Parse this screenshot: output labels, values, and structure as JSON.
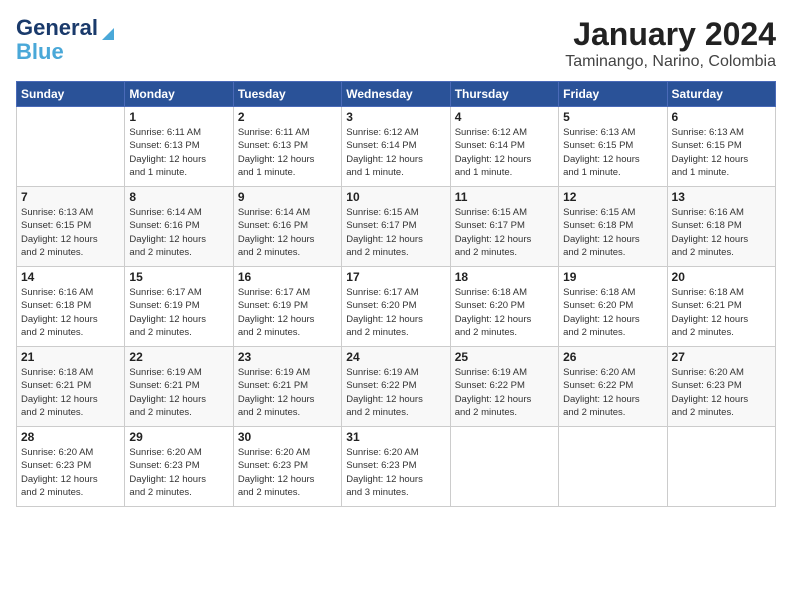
{
  "logo": {
    "line1": "General",
    "line2": "Blue"
  },
  "header": {
    "title": "January 2024",
    "location": "Taminango, Narino, Colombia"
  },
  "days_of_week": [
    "Sunday",
    "Monday",
    "Tuesday",
    "Wednesday",
    "Thursday",
    "Friday",
    "Saturday"
  ],
  "weeks": [
    [
      {
        "day": "",
        "info": ""
      },
      {
        "day": "1",
        "info": "Sunrise: 6:11 AM\nSunset: 6:13 PM\nDaylight: 12 hours\nand 1 minute."
      },
      {
        "day": "2",
        "info": "Sunrise: 6:11 AM\nSunset: 6:13 PM\nDaylight: 12 hours\nand 1 minute."
      },
      {
        "day": "3",
        "info": "Sunrise: 6:12 AM\nSunset: 6:14 PM\nDaylight: 12 hours\nand 1 minute."
      },
      {
        "day": "4",
        "info": "Sunrise: 6:12 AM\nSunset: 6:14 PM\nDaylight: 12 hours\nand 1 minute."
      },
      {
        "day": "5",
        "info": "Sunrise: 6:13 AM\nSunset: 6:15 PM\nDaylight: 12 hours\nand 1 minute."
      },
      {
        "day": "6",
        "info": "Sunrise: 6:13 AM\nSunset: 6:15 PM\nDaylight: 12 hours\nand 1 minute."
      }
    ],
    [
      {
        "day": "7",
        "info": "Sunrise: 6:13 AM\nSunset: 6:15 PM\nDaylight: 12 hours\nand 2 minutes."
      },
      {
        "day": "8",
        "info": "Sunrise: 6:14 AM\nSunset: 6:16 PM\nDaylight: 12 hours\nand 2 minutes."
      },
      {
        "day": "9",
        "info": "Sunrise: 6:14 AM\nSunset: 6:16 PM\nDaylight: 12 hours\nand 2 minutes."
      },
      {
        "day": "10",
        "info": "Sunrise: 6:15 AM\nSunset: 6:17 PM\nDaylight: 12 hours\nand 2 minutes."
      },
      {
        "day": "11",
        "info": "Sunrise: 6:15 AM\nSunset: 6:17 PM\nDaylight: 12 hours\nand 2 minutes."
      },
      {
        "day": "12",
        "info": "Sunrise: 6:15 AM\nSunset: 6:18 PM\nDaylight: 12 hours\nand 2 minutes."
      },
      {
        "day": "13",
        "info": "Sunrise: 6:16 AM\nSunset: 6:18 PM\nDaylight: 12 hours\nand 2 minutes."
      }
    ],
    [
      {
        "day": "14",
        "info": "Sunrise: 6:16 AM\nSunset: 6:18 PM\nDaylight: 12 hours\nand 2 minutes."
      },
      {
        "day": "15",
        "info": "Sunrise: 6:17 AM\nSunset: 6:19 PM\nDaylight: 12 hours\nand 2 minutes."
      },
      {
        "day": "16",
        "info": "Sunrise: 6:17 AM\nSunset: 6:19 PM\nDaylight: 12 hours\nand 2 minutes."
      },
      {
        "day": "17",
        "info": "Sunrise: 6:17 AM\nSunset: 6:20 PM\nDaylight: 12 hours\nand 2 minutes."
      },
      {
        "day": "18",
        "info": "Sunrise: 6:18 AM\nSunset: 6:20 PM\nDaylight: 12 hours\nand 2 minutes."
      },
      {
        "day": "19",
        "info": "Sunrise: 6:18 AM\nSunset: 6:20 PM\nDaylight: 12 hours\nand 2 minutes."
      },
      {
        "day": "20",
        "info": "Sunrise: 6:18 AM\nSunset: 6:21 PM\nDaylight: 12 hours\nand 2 minutes."
      }
    ],
    [
      {
        "day": "21",
        "info": "Sunrise: 6:18 AM\nSunset: 6:21 PM\nDaylight: 12 hours\nand 2 minutes."
      },
      {
        "day": "22",
        "info": "Sunrise: 6:19 AM\nSunset: 6:21 PM\nDaylight: 12 hours\nand 2 minutes."
      },
      {
        "day": "23",
        "info": "Sunrise: 6:19 AM\nSunset: 6:21 PM\nDaylight: 12 hours\nand 2 minutes."
      },
      {
        "day": "24",
        "info": "Sunrise: 6:19 AM\nSunset: 6:22 PM\nDaylight: 12 hours\nand 2 minutes."
      },
      {
        "day": "25",
        "info": "Sunrise: 6:19 AM\nSunset: 6:22 PM\nDaylight: 12 hours\nand 2 minutes."
      },
      {
        "day": "26",
        "info": "Sunrise: 6:20 AM\nSunset: 6:22 PM\nDaylight: 12 hours\nand 2 minutes."
      },
      {
        "day": "27",
        "info": "Sunrise: 6:20 AM\nSunset: 6:23 PM\nDaylight: 12 hours\nand 2 minutes."
      }
    ],
    [
      {
        "day": "28",
        "info": "Sunrise: 6:20 AM\nSunset: 6:23 PM\nDaylight: 12 hours\nand 2 minutes."
      },
      {
        "day": "29",
        "info": "Sunrise: 6:20 AM\nSunset: 6:23 PM\nDaylight: 12 hours\nand 2 minutes."
      },
      {
        "day": "30",
        "info": "Sunrise: 6:20 AM\nSunset: 6:23 PM\nDaylight: 12 hours\nand 2 minutes."
      },
      {
        "day": "31",
        "info": "Sunrise: 6:20 AM\nSunset: 6:23 PM\nDaylight: 12 hours\nand 3 minutes."
      },
      {
        "day": "",
        "info": ""
      },
      {
        "day": "",
        "info": ""
      },
      {
        "day": "",
        "info": ""
      }
    ]
  ]
}
